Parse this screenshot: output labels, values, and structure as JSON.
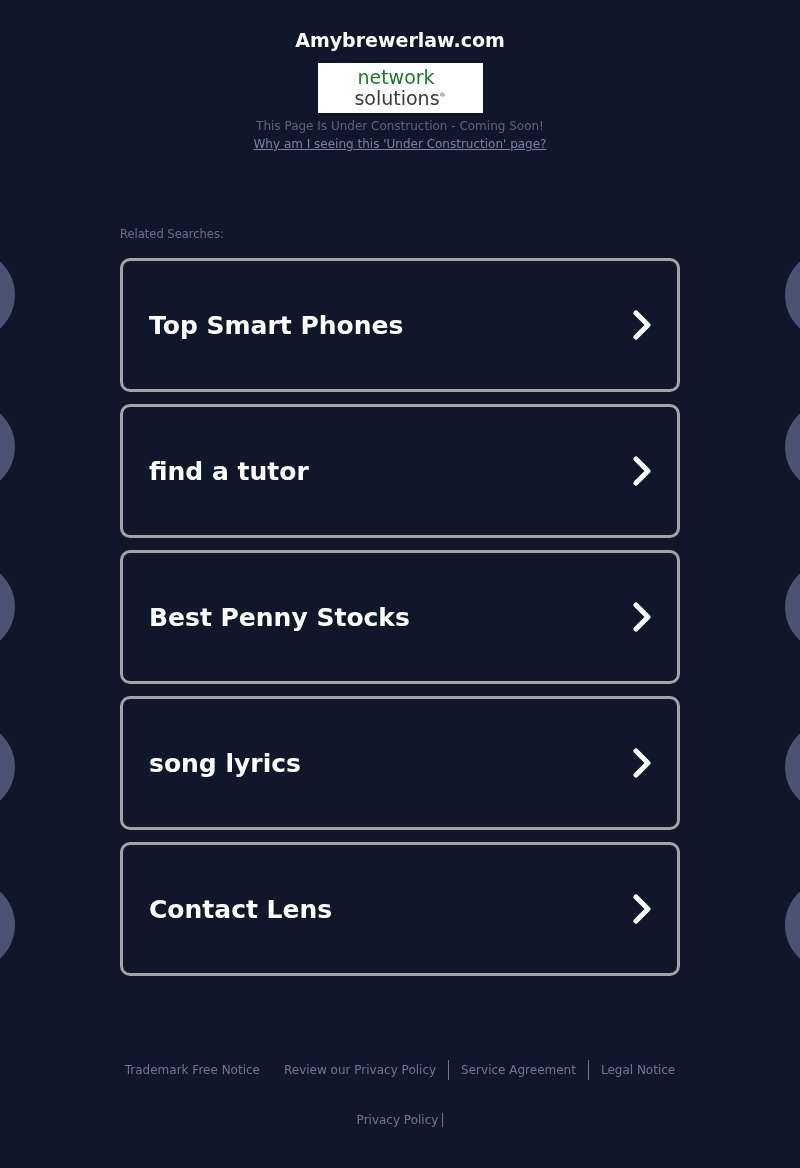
{
  "title": "Amybrewerlaw.com",
  "logo": {
    "line_1": "network",
    "line_2": "solutions",
    "mark": "®"
  },
  "notice": "This Page Is Under Construction - Coming Soon!",
  "notice_link": "Why am I seeing this 'Under Construction' page?",
  "related_label": "Related Searches:",
  "searches": [
    {
      "label": "Top Smart Phones"
    },
    {
      "label": "find a tutor"
    },
    {
      "label": "Best Penny Stocks"
    },
    {
      "label": "song lyrics"
    },
    {
      "label": "Contact Lens"
    }
  ],
  "footer_links": [
    {
      "label": "Trademark Free Notice",
      "divider": false
    },
    {
      "label": "Review our Privacy Policy",
      "divider": true
    },
    {
      "label": "Service Agreement",
      "divider": true
    },
    {
      "label": "Legal Notice",
      "divider": false
    }
  ],
  "bottom_link": {
    "label": "Privacy Policy",
    "divider": true
  }
}
